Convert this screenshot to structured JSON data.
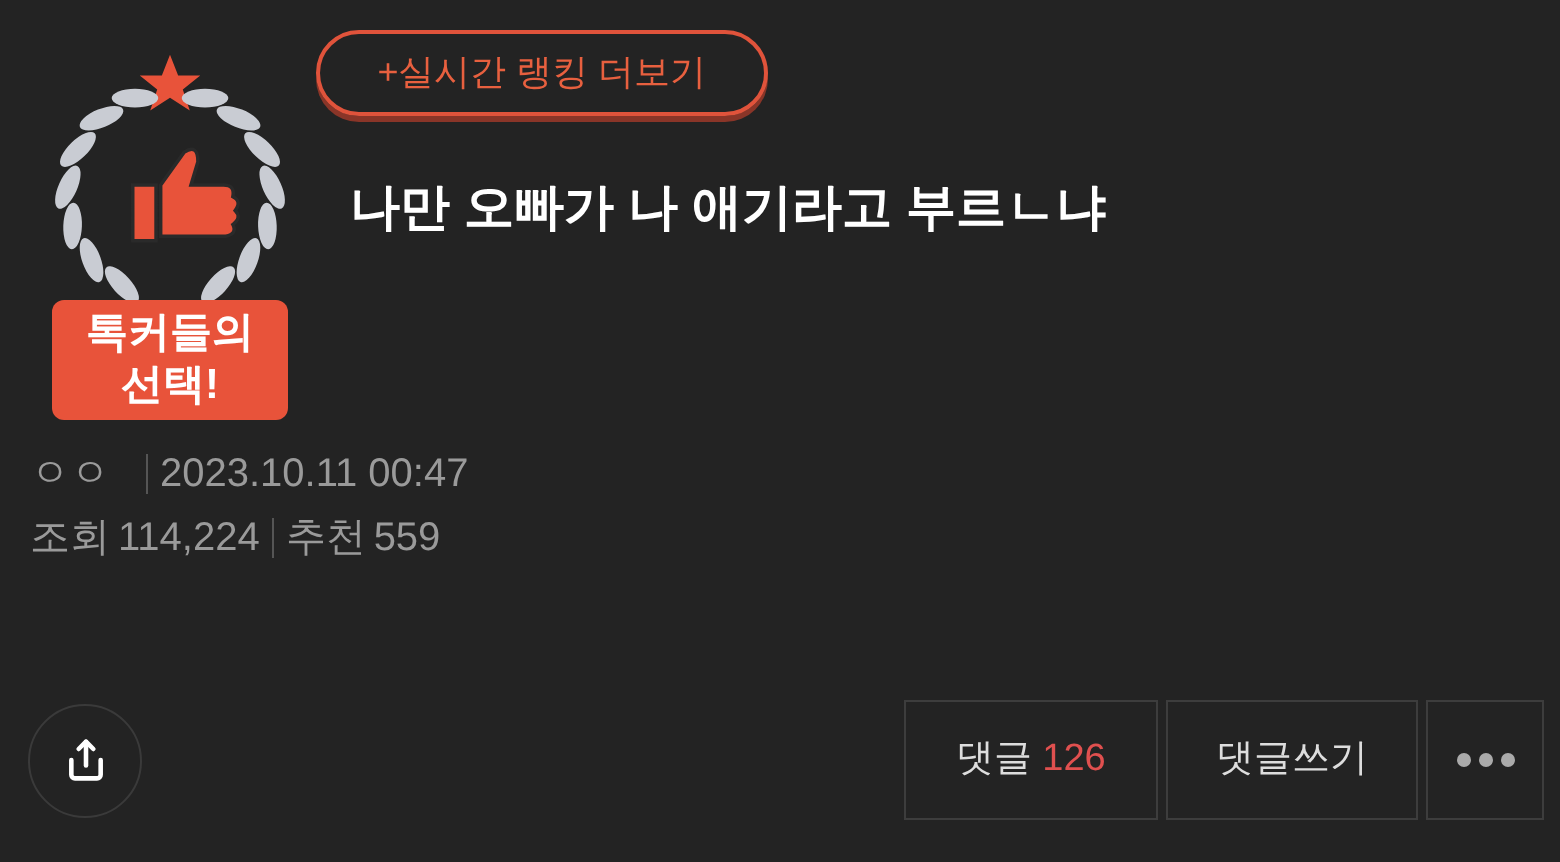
{
  "badge": {
    "label_lines": [
      "톡커들의",
      "선택!"
    ]
  },
  "ranking_link": "+실시간 랭킹 더보기",
  "title": "나만 오빠가 나 애기라고 부르ㄴ냐",
  "meta": {
    "author": "ㅇㅇ",
    "date": "2023.10.11 00:47",
    "views_label": "조회",
    "views": "114,224",
    "likes_label": "추천",
    "likes": "559"
  },
  "actions": {
    "comments_label": "댓글",
    "comments_count": "126",
    "write_comment": "댓글쓰기"
  }
}
